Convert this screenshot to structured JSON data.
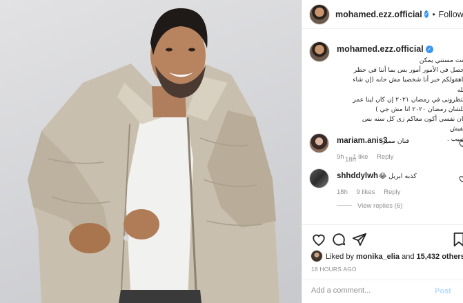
{
  "photo": {
    "description_icon": "photo-person-icon"
  },
  "header": {
    "username": "mohamed.ezz.official",
    "verified_icon": "verified-badge-icon",
    "separator": "•",
    "follow_label": "Following"
  },
  "caption": {
    "username": "mohamed.ezz.official",
    "text": "كنت مستني يمكن\nيحصل في الأمور أمور بس بما أننا في حظر\nفاهقولكم خبر أنا شخصيا مش حابه (إن شاء الله\nالتظرونى في رمضان ٢٠٢١ إن كان لينا عمر\nعلشان رمضان ٢٠٢٠ انا مش جي )\nكان نفسي أكون معاكم زى كل سنه بس مفيش\nنصيب .",
    "time": "18h"
  },
  "comments": [
    {
      "username": "mariam.anis3",
      "text": "فنان مميز",
      "time": "9h",
      "likes": "1 like",
      "reply": "Reply"
    },
    {
      "username": "shhddylwh",
      "text": "كذبه ابريل 😂",
      "time": "18h",
      "likes": "9 likes",
      "reply": "Reply"
    }
  ],
  "view_replies": "View replies (6)",
  "actions": {
    "icons": [
      "heart-icon",
      "comment-icon",
      "share-icon",
      "bookmark-icon"
    ],
    "liked_prefix": "Liked by",
    "liked_user": "monika_elia",
    "liked_and": "and",
    "liked_count": "15,432 others",
    "time_ago": "18 HOURS AGO"
  },
  "add_comment": {
    "placeholder": "Add a comment...",
    "post_label": "Post"
  }
}
